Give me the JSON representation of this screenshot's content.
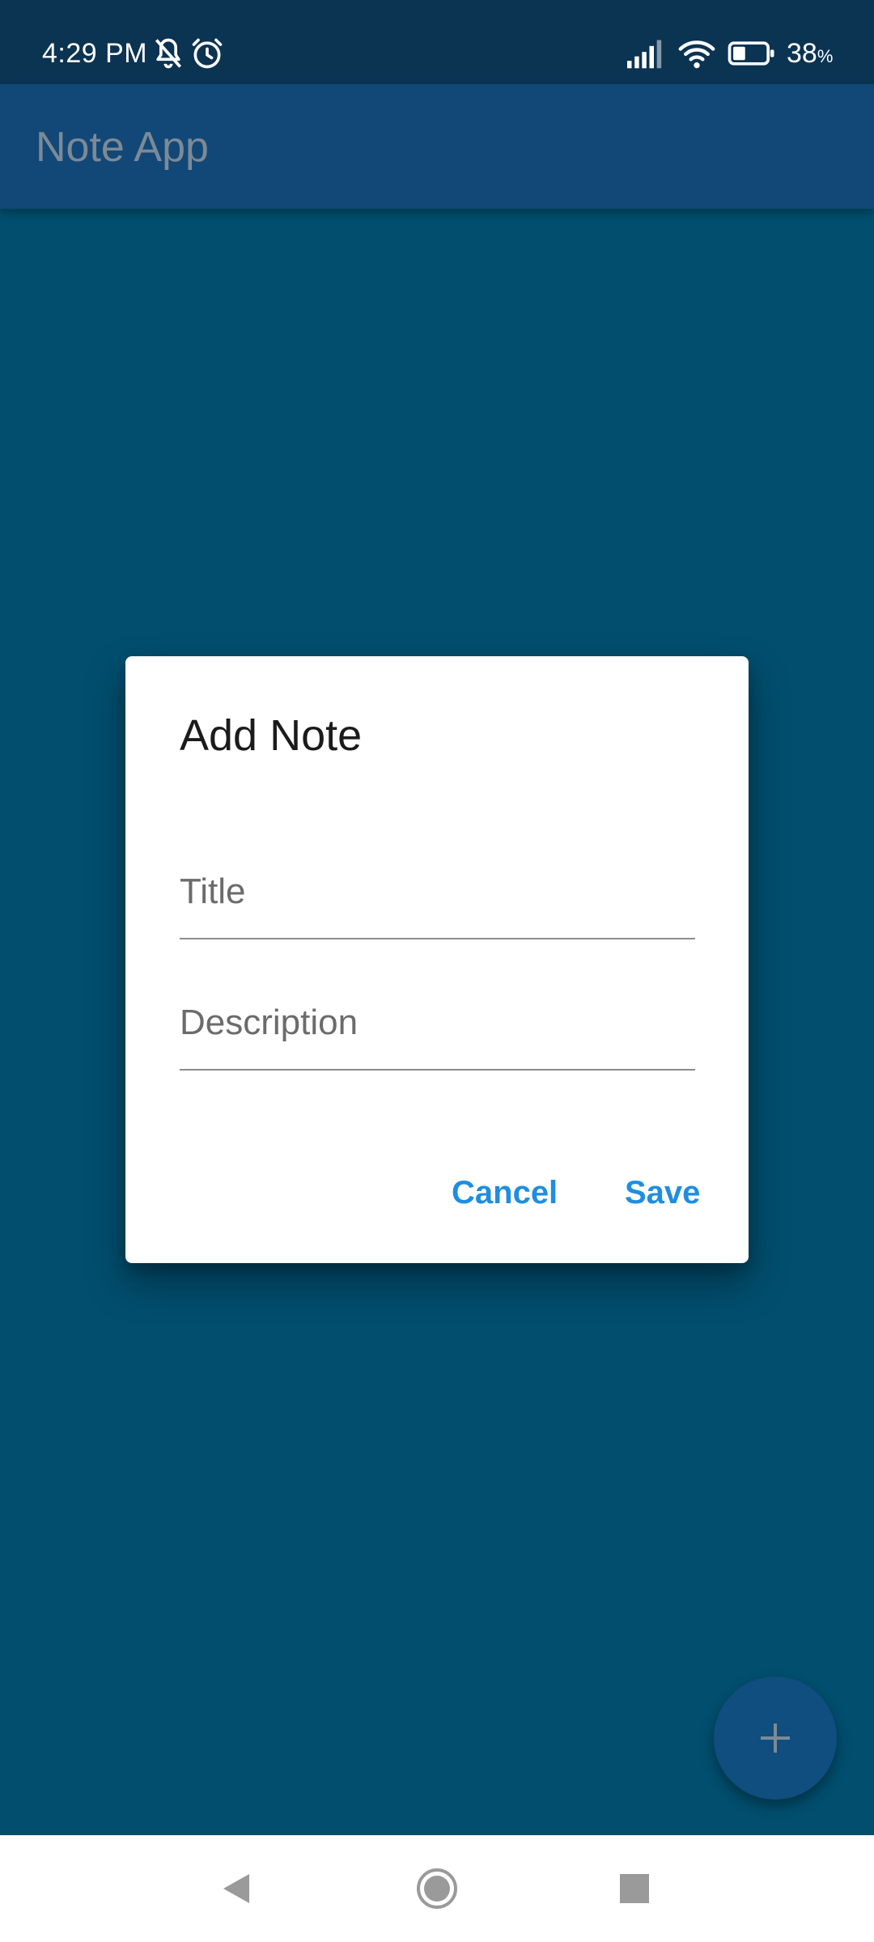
{
  "status_bar": {
    "time": "4:29 PM",
    "battery_percent": "38",
    "battery_percent_suffix": "%",
    "icons": [
      "bell-off-icon",
      "alarm-icon",
      "signal-icon",
      "wifi-icon",
      "battery-icon"
    ],
    "battery_level": 0.38
  },
  "app_bar": {
    "title": "Note App"
  },
  "dialog": {
    "title": "Add Note",
    "title_field": {
      "placeholder": "Title",
      "value": ""
    },
    "description_field": {
      "placeholder": "Description",
      "value": ""
    },
    "cancel_label": "Cancel",
    "save_label": "Save"
  },
  "fab": {
    "icon": "plus-icon"
  },
  "nav_bar": {
    "icons": [
      "back-icon",
      "home-icon",
      "recents-icon"
    ]
  },
  "colors": {
    "background": "#024e6e",
    "status_bar": "#0b3352",
    "app_bar": "#124877",
    "accent": "#1f8ee0",
    "fab": "#0f4e7e"
  }
}
